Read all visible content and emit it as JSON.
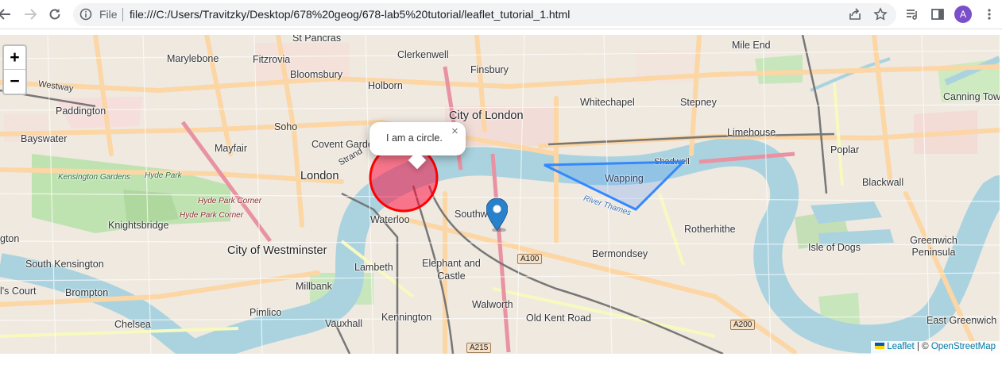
{
  "browser": {
    "url_scheme_label": "File",
    "url": "file:///C:/Users/Travitzky/Desktop/678%20geog/678-lab5%20tutorial/leaflet_tutorial_1.html",
    "profile_initial": "A",
    "icons": [
      "back-arrow-icon",
      "forward-arrow-icon",
      "reload-icon",
      "info-icon",
      "share-icon",
      "star-icon",
      "tab-search-icon",
      "side-panel-icon",
      "kebab-menu-icon"
    ]
  },
  "map": {
    "zoom_in": "+",
    "zoom_out": "−",
    "popup": {
      "text": "I am a circle.",
      "close": "×"
    },
    "circle": {
      "color": "#ff0000",
      "fill": "#f03"
    },
    "polygon": {
      "color": "#3388ff"
    },
    "marker_color": "#2a81cb",
    "attribution": {
      "leaflet": "Leaflet",
      "sep": "| ©",
      "osm": "OpenStreetMap"
    },
    "labels": {
      "st_pancras": "St Pancras",
      "marylebone": "Marylebone",
      "fitzrovia": "Fitzrovia",
      "clerkenwell": "Clerkenwell",
      "finsbury": "Finsbury",
      "bloomsbury": "Bloomsbury",
      "holborn": "Holborn",
      "paddington": "Paddington",
      "bayswater": "Bayswater",
      "soho": "Soho",
      "mayfair": "Mayfair",
      "covent_garden": "Covent Garden",
      "city_of_london": "City of London",
      "whitechapel": "Whitechapel",
      "stepney": "Stepney",
      "mile_end": "Mile End",
      "canning_town": "Canning Town",
      "limehouse": "Limehouse",
      "poplar": "Poplar",
      "shadwell": "Shadwell",
      "wapping": "Wapping",
      "blackwall": "Blackwall",
      "london": "London",
      "strand": "Strand",
      "kensington_gardens": "Kensington Gardens",
      "hyde_park": "Hyde Park",
      "hyde_park_corner": "Hyde Park Corner",
      "hyde_park_corner_2": "Hyde Park Corner",
      "knightsbridge": "Knightsbridge",
      "waterloo": "Waterloo",
      "southwark": "Southwark",
      "rotherhithe": "Rotherhithe",
      "city_of_westminster": "City of Westminster",
      "south_kensington": "South Kensington",
      "lambeth": "Lambeth",
      "elephant_and_castle": "Elephant and Castle",
      "bermondsey": "Bermondsey",
      "isle_of_dogs": "Isle of Dogs",
      "greenwich_peninsula": "Greenwich Peninsula",
      "millbank": "Millbank",
      "brompton": "Brompton",
      "earls_court": "l's Court",
      "walworth": "Walworth",
      "pimlico": "Pimlico",
      "chelsea": "Chelsea",
      "vauxhall": "Vauxhall",
      "kennington": "Kennington",
      "old_kent_road": "Old Kent Road",
      "east_greenwich": "East Greenwich",
      "river_thames": "River Thames",
      "westway": "Westway",
      "gton": "gton"
    },
    "shields": {
      "a100": "A100",
      "a200": "A200",
      "a215": "A215"
    }
  }
}
